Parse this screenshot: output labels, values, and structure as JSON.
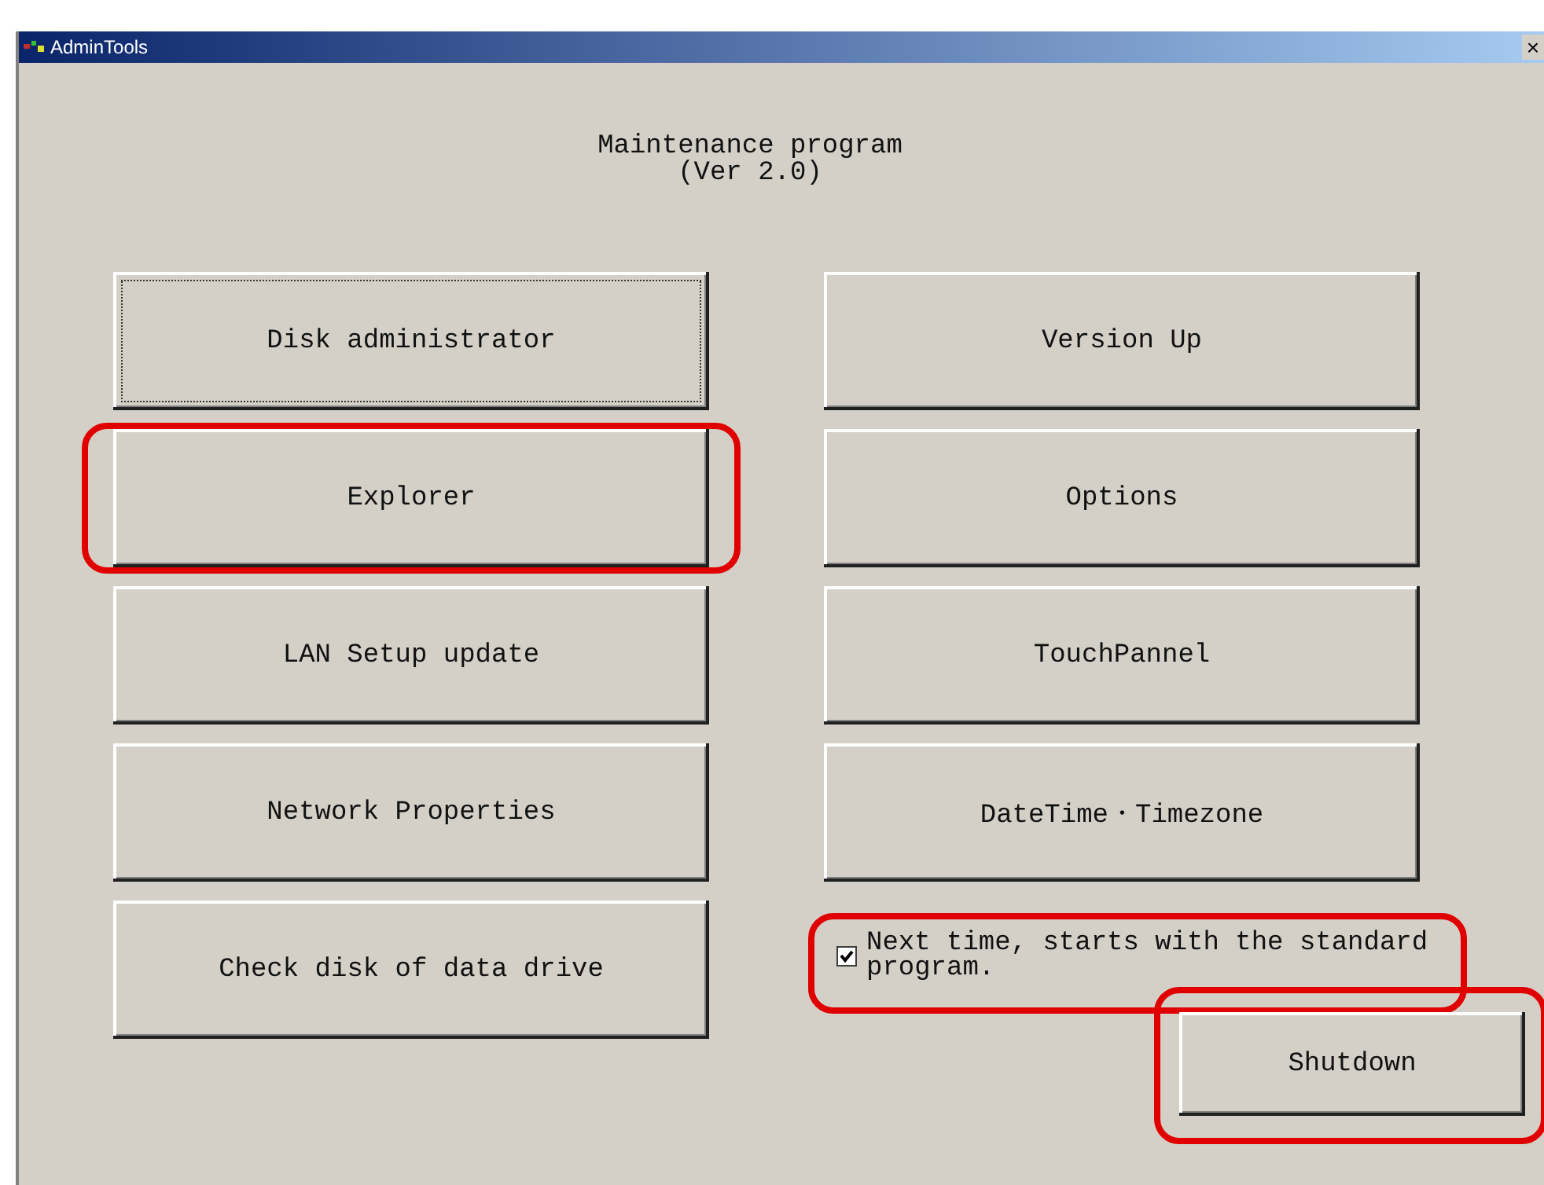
{
  "window": {
    "title": "AdminTools",
    "close": "×"
  },
  "heading": [
    "Maintenance program",
    "(Ver 2.0)"
  ],
  "buttons_left": [
    {
      "label": "Disk administrator",
      "focused": true,
      "highlighted": false
    },
    {
      "label": "Explorer",
      "focused": false,
      "highlighted": true
    },
    {
      "label": "LAN Setup update",
      "focused": false,
      "highlighted": false
    },
    {
      "label": "Network Properties",
      "focused": false,
      "highlighted": false
    },
    {
      "label": "Check disk of data drive",
      "focused": false,
      "highlighted": false
    }
  ],
  "buttons_right": [
    {
      "label": "Version Up",
      "focused": false,
      "highlighted": false
    },
    {
      "label": "Options",
      "focused": false,
      "highlighted": false
    },
    {
      "label": "TouchPannel",
      "focused": false,
      "highlighted": false
    },
    {
      "label": "DateTime・Timezone",
      "focused": false,
      "highlighted": false
    }
  ],
  "startup_checkbox": {
    "label": "Next time, starts with the standard program.",
    "checked": true,
    "highlighted": true
  },
  "shutdown": {
    "label": "Shutdown",
    "highlighted": true
  }
}
